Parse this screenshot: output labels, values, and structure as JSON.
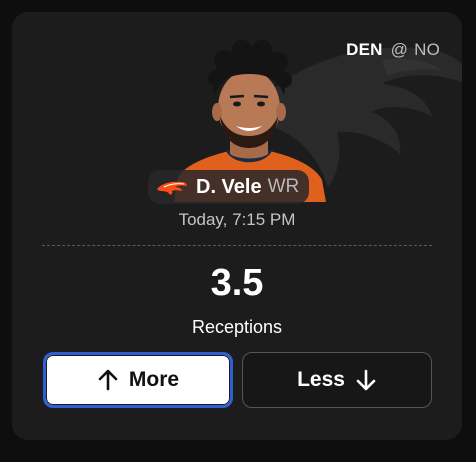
{
  "matchup": {
    "home": "DEN",
    "at": "@",
    "away": "NO"
  },
  "player": {
    "name": "D. Vele",
    "position": "WR"
  },
  "game_time": "Today, 7:15 PM",
  "projection": {
    "line": "3.5",
    "stat": "Receptions"
  },
  "buttons": {
    "more_label": "More",
    "less_label": "Less"
  },
  "colors": {
    "card_bg": "#1c1c1d",
    "selected_border": "#2f5fd0",
    "team_orange": "#fb4f14",
    "jersey_orange": "#e0601e"
  },
  "icons": {
    "team_logo": "broncos-logo-icon",
    "more": "arrow-up-icon",
    "less": "arrow-down-icon"
  }
}
